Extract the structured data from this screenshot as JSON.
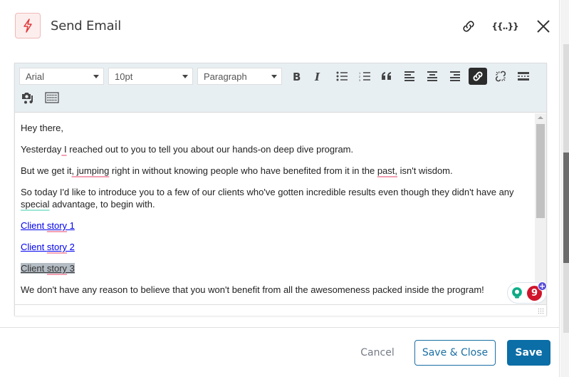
{
  "header": {
    "icon": "lightning-bolt-icon",
    "title": "Send Email",
    "actions": [
      {
        "name": "link-icon",
        "label": "Copy link"
      },
      {
        "name": "merge-fields-icon",
        "label": "{{..}}"
      },
      {
        "name": "close-icon",
        "label": "Close"
      }
    ],
    "merge_label": "{{..}}"
  },
  "toolbar": {
    "font": "Arial",
    "size": "10pt",
    "format": "Paragraph",
    "buttons": [
      "bold",
      "italic",
      "bullet-list",
      "numbered-list",
      "blockquote",
      "align-left",
      "align-center",
      "align-right",
      "insert-link",
      "unlink",
      "horizontal-rule",
      "insert-media",
      "keyboard"
    ],
    "active_button": "insert-link"
  },
  "body": {
    "greeting": "Hey there,",
    "p1_before": "Yesterday",
    "p1_err": " I",
    "p1_after": " reached out to you to tell you about our hands-on deep dive program.",
    "p2_before": "But we get it",
    "p2_err": ", jumping",
    "p2_mid": " right in without knowing people who have benefited from it in the ",
    "p2_err2": "past,",
    "p2_after": " isn't wisdom.",
    "p3_line": "So today I'd like to introduce you to a few of our clients who've gotten incredible results even though they didn't have any ",
    "p3_err": "special",
    "p3_after": " advantage, to begin with.",
    "links": [
      {
        "pre": "Client ",
        "err": "story",
        "post": " 1"
      },
      {
        "pre": "Client ",
        "err": "story",
        "post": " 2"
      },
      {
        "pre": "Client ",
        "err": "story",
        "post": " 3"
      }
    ],
    "closing": "We don't have any reason to believe that you won't benefit from all the awesomeness packed inside the program!"
  },
  "grammarly": {
    "count": "9",
    "plus": "+"
  },
  "footer": {
    "cancel": "Cancel",
    "save_close": "Save & Close",
    "save": "Save"
  },
  "colors": {
    "accent": "#0b6ea6",
    "trigger": "#e03a3a",
    "grammarly_count": "#d0142c"
  }
}
